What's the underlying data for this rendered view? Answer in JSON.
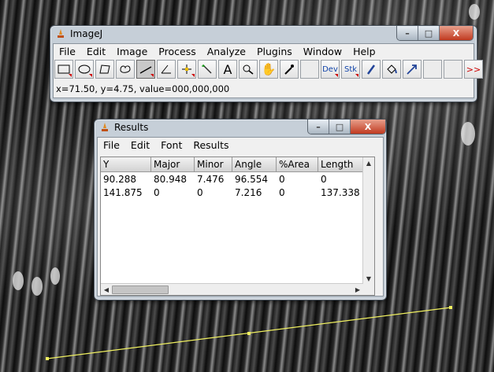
{
  "imagej": {
    "title": "ImageJ",
    "menu": [
      "File",
      "Edit",
      "Image",
      "Process",
      "Analyze",
      "Plugins",
      "Window",
      "Help"
    ],
    "tools": [
      "rectangle-tool",
      "oval-tool",
      "polygon-tool",
      "freehand-tool",
      "line-tool",
      "angle-tool",
      "point-tool",
      "wand-tool",
      "text-tool",
      "magnifier-tool",
      "hand-tool",
      "color-picker-tool"
    ],
    "dev_label": "Dev",
    "stk_label": "Stk",
    "more_label": ">>",
    "status": "x=71.50, y=4.75, value=000,000,000"
  },
  "results": {
    "title": "Results",
    "menu": [
      "File",
      "Edit",
      "Font",
      "Results"
    ],
    "columns": [
      "Y",
      "Major",
      "Minor",
      "Angle",
      "%Area",
      "Length"
    ],
    "rows": [
      [
        "90.288",
        "80.948",
        "7.476",
        "96.554",
        "0",
        "0"
      ],
      [
        "141.875",
        "0",
        "0",
        "7.216",
        "0",
        "137.338"
      ]
    ]
  },
  "window_buttons": {
    "minimize": "–",
    "maximize": "□",
    "close": "X"
  },
  "colors": {
    "selection_line": "#f0f060",
    "titlebar": "#c6cfd8",
    "close_button": "#c03a20"
  }
}
